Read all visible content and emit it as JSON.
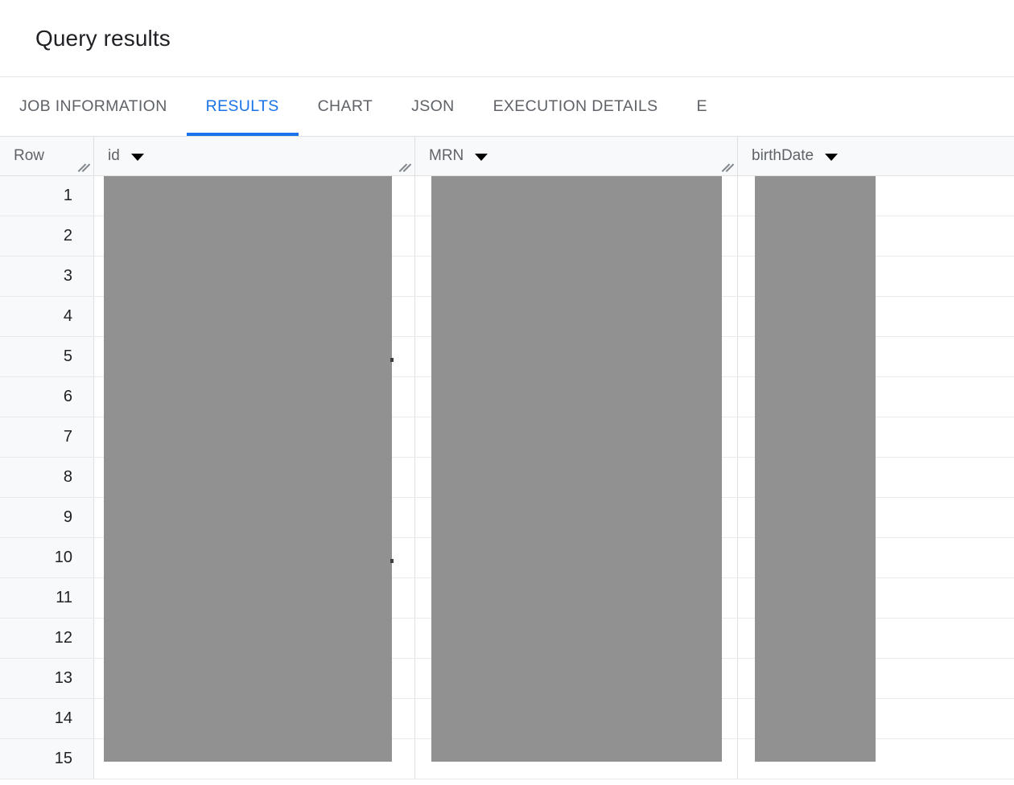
{
  "header": {
    "title": "Query results"
  },
  "tabs": [
    {
      "label": "JOB INFORMATION",
      "active": false,
      "name": "tab-job-information"
    },
    {
      "label": "RESULTS",
      "active": true,
      "name": "tab-results"
    },
    {
      "label": "CHART",
      "active": false,
      "name": "tab-chart"
    },
    {
      "label": "JSON",
      "active": false,
      "name": "tab-json"
    },
    {
      "label": "EXECUTION DETAILS",
      "active": false,
      "name": "tab-execution-details"
    },
    {
      "label": "E",
      "active": false,
      "name": "tab-clipped"
    }
  ],
  "table": {
    "row_header": "Row",
    "columns": [
      {
        "label": "id",
        "name": "column-header-id",
        "menu_icon": "caret-down-icon",
        "resize_icon": "resize-grip-icon"
      },
      {
        "label": "MRN",
        "name": "column-header-mrn",
        "menu_icon": "caret-down-icon",
        "resize_icon": "resize-grip-icon"
      },
      {
        "label": "birthDate",
        "name": "column-header-birthdate",
        "menu_icon": "caret-down-icon",
        "resize_icon": "resize-grip-icon"
      }
    ],
    "rows": [
      {
        "row": "1"
      },
      {
        "row": "2"
      },
      {
        "row": "3"
      },
      {
        "row": "4"
      },
      {
        "row": "5"
      },
      {
        "row": "6"
      },
      {
        "row": "7"
      },
      {
        "row": "8"
      },
      {
        "row": "9"
      },
      {
        "row": "10"
      },
      {
        "row": "11"
      },
      {
        "row": "12"
      },
      {
        "row": "13"
      },
      {
        "row": "14"
      },
      {
        "row": "15"
      }
    ],
    "redacted_note": "Cell values for id, MRN and birthDate are obscured by solid gray blocks."
  },
  "colors": {
    "accent": "#1a73e8",
    "text_primary": "#202124",
    "text_secondary": "#5f6368",
    "header_bg": "#f8f9fa",
    "grid_line": "#e0e0e0",
    "row_line": "#e8eaed",
    "redaction": "#919191"
  }
}
